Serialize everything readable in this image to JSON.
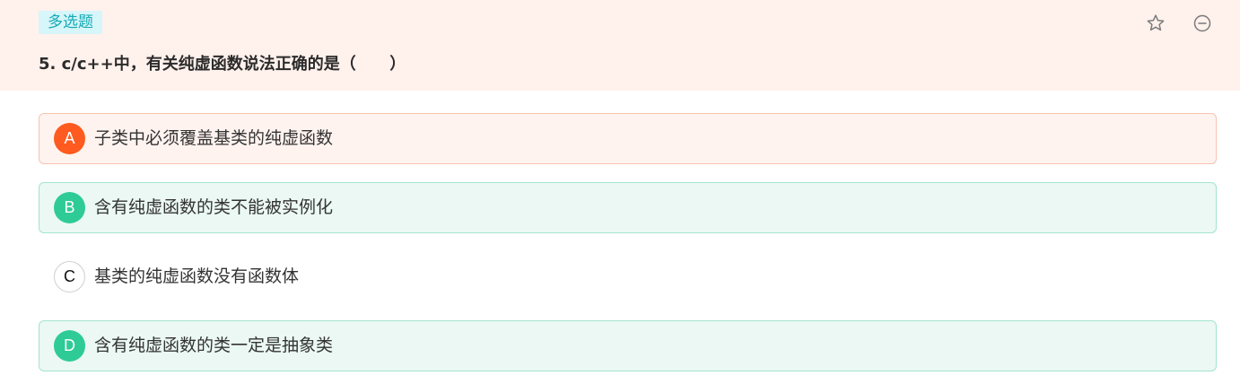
{
  "question": {
    "type_tag": "多选题",
    "title": "5. c/c++中，有关纯虚函数说法正确的是（      ）"
  },
  "icons": {
    "favorite": "star-outline-icon",
    "collapse": "minus-circle-icon"
  },
  "colors": {
    "header_bg": "#fff1ec",
    "tag_bg": "#d6f6f9",
    "tag_text": "#15aab5",
    "wrong_badge": "#ff5a1f",
    "correct_badge": "#2ecb96"
  },
  "options": [
    {
      "letter": "A",
      "text": "子类中必须覆盖基类的纯虚函数",
      "state": "wrong"
    },
    {
      "letter": "B",
      "text": "含有纯虚函数的类不能被实例化",
      "state": "correct"
    },
    {
      "letter": "C",
      "text": "基类的纯虚函数没有函数体",
      "state": "unselected"
    },
    {
      "letter": "D",
      "text": "含有纯虚函数的类一定是抽象类",
      "state": "correct"
    }
  ]
}
